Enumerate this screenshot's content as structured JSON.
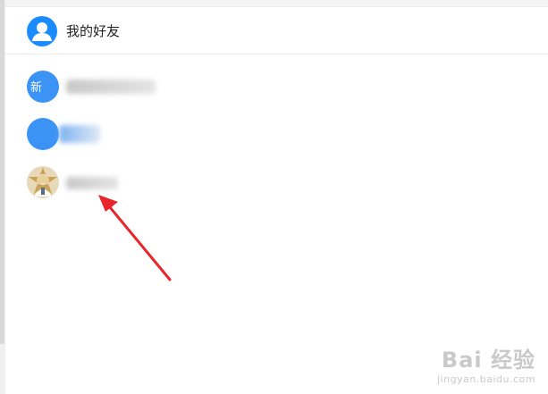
{
  "header": {
    "title": "我的好友",
    "icon": "user-icon"
  },
  "friends": [
    {
      "avatar_text": "新",
      "name": ""
    },
    {
      "avatar_text": "",
      "name": ""
    },
    {
      "avatar_text": "",
      "name": ""
    }
  ],
  "watermark": {
    "brand": "Bai 经验",
    "url": "jingyan.baidu.com"
  },
  "colors": {
    "accent": "#1a8cff",
    "avatar_blue": "#3a93f5",
    "arrow": "#e8262a"
  }
}
